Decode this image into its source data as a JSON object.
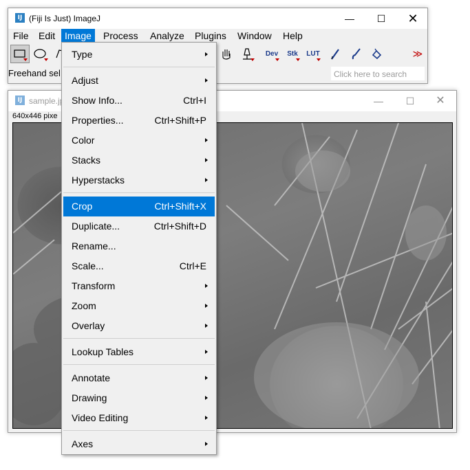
{
  "main_window": {
    "title": "(Fiji Is Just) ImageJ",
    "icon_text": "IJ",
    "menus": [
      "File",
      "Edit",
      "Image",
      "Process",
      "Analyze",
      "Plugins",
      "Window",
      "Help"
    ],
    "active_menu": "Image",
    "toolbar": {
      "dev_label": "Dev",
      "stk_label": "Stk",
      "lut_label": "LUT",
      "more_label": "≫"
    },
    "status_text": "Freehand sel",
    "search_placeholder": "Click here to search"
  },
  "image_window": {
    "title": "sample.jp",
    "info": "640x446 pixe"
  },
  "image_menu": {
    "items": [
      {
        "label": "Type",
        "shortcut": "",
        "submenu": true
      },
      {
        "label": "Adjust",
        "shortcut": "",
        "submenu": true
      },
      {
        "label": "Show Info...",
        "shortcut": "Ctrl+I",
        "submenu": false
      },
      {
        "label": "Properties...",
        "shortcut": "Ctrl+Shift+P",
        "submenu": false
      },
      {
        "label": "Color",
        "shortcut": "",
        "submenu": true
      },
      {
        "label": "Stacks",
        "shortcut": "",
        "submenu": true
      },
      {
        "label": "Hyperstacks",
        "shortcut": "",
        "submenu": true
      },
      {
        "label": "Crop",
        "shortcut": "Ctrl+Shift+X",
        "submenu": false,
        "highlighted": true
      },
      {
        "label": "Duplicate...",
        "shortcut": "Ctrl+Shift+D",
        "submenu": false
      },
      {
        "label": "Rename...",
        "shortcut": "",
        "submenu": false
      },
      {
        "label": "Scale...",
        "shortcut": "Ctrl+E",
        "submenu": false
      },
      {
        "label": "Transform",
        "shortcut": "",
        "submenu": true
      },
      {
        "label": "Zoom",
        "shortcut": "",
        "submenu": true
      },
      {
        "label": "Overlay",
        "shortcut": "",
        "submenu": true
      },
      {
        "label": "Lookup Tables",
        "shortcut": "",
        "submenu": true
      },
      {
        "label": "Annotate",
        "shortcut": "",
        "submenu": true
      },
      {
        "label": "Drawing",
        "shortcut": "",
        "submenu": true
      },
      {
        "label": "Video Editing",
        "shortcut": "",
        "submenu": true
      },
      {
        "label": "Axes",
        "shortcut": "",
        "submenu": true
      }
    ]
  },
  "colors": {
    "highlight": "#0078d7",
    "menu_bg": "#f0f0f0",
    "tool_triangle": "#c00000"
  }
}
